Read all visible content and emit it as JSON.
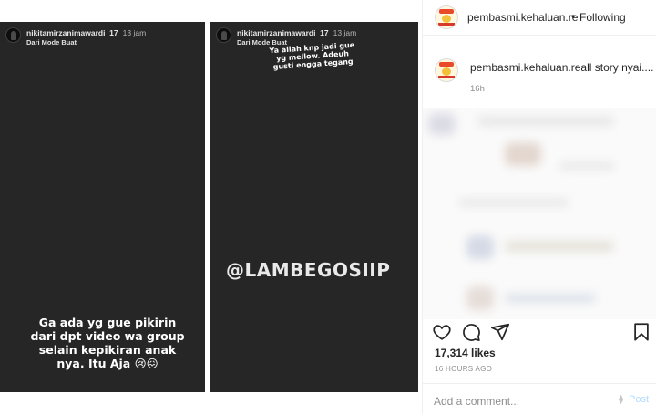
{
  "stories": [
    {
      "username": "nikitamirzanimawardi_17",
      "time": "13 jam",
      "mode": "Dari Mode Buat",
      "caption": "Ga ada yg gue pikirin dari dpt video wa group selain kepikiran anak nya. Itu Aja 😢😖"
    },
    {
      "username": "nikitamirzanimawardi_17",
      "time": "13 jam",
      "mode": "Dari Mode Buat",
      "caption": "Ya allah knp jadi gue yg mellow. Adeuh gusti engga tegang",
      "watermark": "@LAMBEGOSIIP"
    }
  ],
  "post": {
    "header_username": "pembasmi.kehaluan.re",
    "separator": "•",
    "follow_status": "Following",
    "comment_username": "pembasmi.kehaluan.reall",
    "comment_text": "story nyai....",
    "comment_age": "16h",
    "likes": "17,314 likes",
    "posted_ago": "16 HOURS AGO",
    "add_comment_placeholder": "Add a comment...",
    "post_label": "Post",
    "action_icons": [
      "heart-icon",
      "comment-icon",
      "share-icon",
      "bookmark-icon"
    ]
  },
  "colors": {
    "story_bg": "#262626",
    "post_button": "#b3dbff",
    "muted_text": "#8e8e8e"
  }
}
